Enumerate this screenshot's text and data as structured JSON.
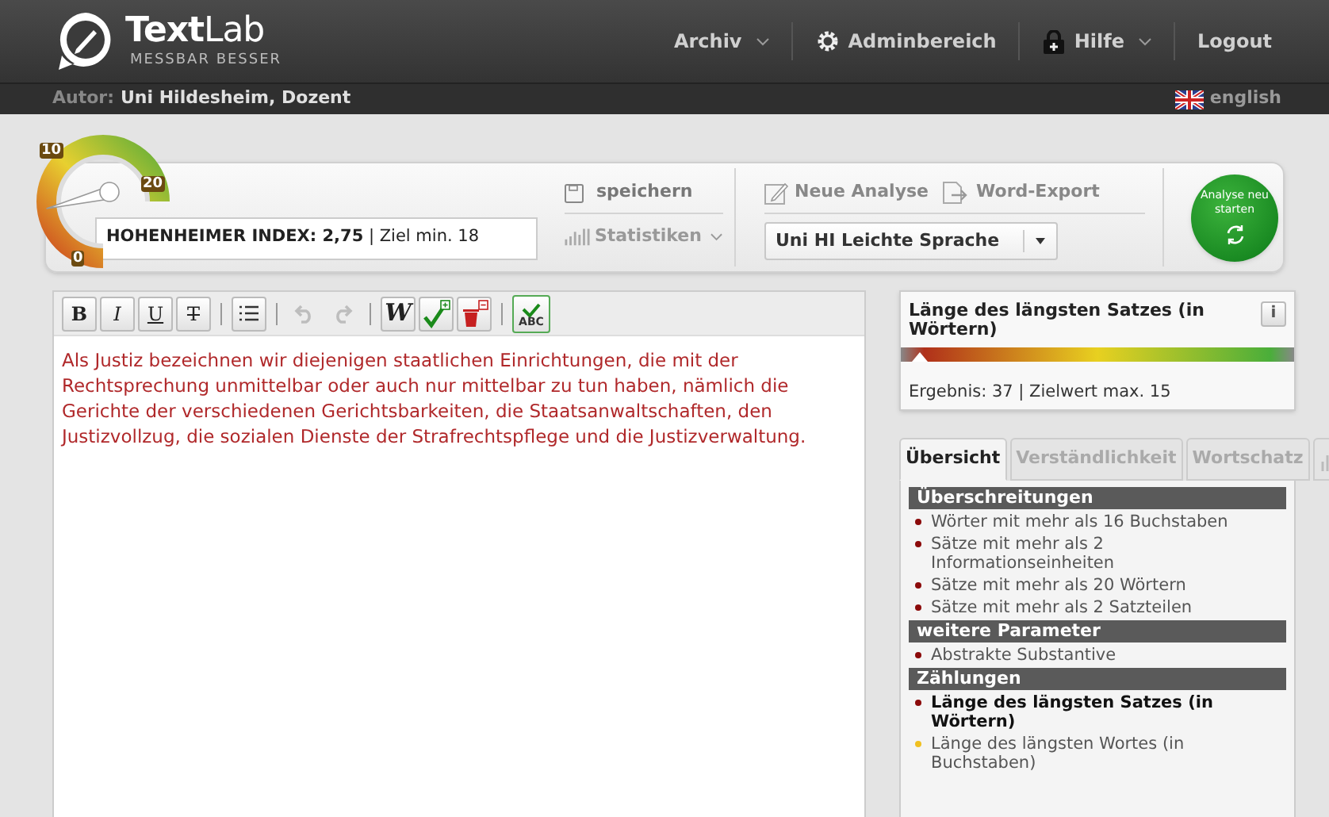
{
  "header": {
    "logo": {
      "title": "**Text**Lab",
      "tagline": "MESSBAR BESSER"
    },
    "nav": [
      {
        "label": "Archiv",
        "kind": "menu",
        "dropdown": true
      },
      {
        "label": "Adminbereich",
        "kind": "admin",
        "dropdown": false
      },
      {
        "label": "Hilfe",
        "kind": "help",
        "dropdown": true
      },
      {
        "label": "Logout",
        "kind": "link",
        "dropdown": false
      }
    ]
  },
  "subbar": {
    "author_label": "Autor:",
    "author": "Uni Hildesheim, Dozent",
    "language": "english"
  },
  "score": {
    "gauge_ticks": [
      "0",
      "10",
      "20"
    ],
    "index": "**HOHENHEIMER INDEX: 2,75** | Ziel min. 18"
  },
  "actions": {
    "save": "speichern",
    "stats": "Statistiken",
    "new_analysis": "Neue Analyse",
    "export": "Word-Export",
    "profile": "Uni HI Leichte Sprache",
    "restart": "Analyse neu starten"
  },
  "editor": {
    "tools": [
      {
        "kind": "bold",
        "label": "B",
        "disabled": false
      },
      {
        "kind": "italic",
        "label": "I",
        "disabled": false
      },
      {
        "kind": "underline",
        "label": "U",
        "disabled": false
      },
      {
        "kind": "strike",
        "label": "T",
        "disabled": false
      },
      {
        "kind": "separator"
      },
      {
        "kind": "list",
        "disabled": false
      },
      {
        "kind": "separator"
      },
      {
        "kind": "undo",
        "disabled": true
      },
      {
        "kind": "redo",
        "disabled": true
      },
      {
        "kind": "separator"
      },
      {
        "kind": "word",
        "label": "W",
        "disabled": false
      },
      {
        "kind": "check-add",
        "disabled": false
      },
      {
        "kind": "delete",
        "disabled": false
      },
      {
        "kind": "separator"
      },
      {
        "kind": "spellcheck",
        "label": "ABC",
        "disabled": false
      }
    ],
    "text": "Als Justiz bezeichnen wir diejenigen staatlichen Einrichtungen, die mit der Rechtsprechung unmittelbar oder auch nur mittelbar zu tun haben, nämlich die Gerichte der verschiedenen Gerichtsbarkeiten, die Staatsanwaltschaften, den Justizvollzug, die sozialen Dienste der Strafrechtspflege und die Justizverwaltung."
  },
  "metric": {
    "title": "Länge des längsten Satzes (in Wörtern)",
    "info": "i",
    "level": 0.05,
    "result": "Ergebnis: 37 | Zielwert max. 15"
  },
  "tabs": [
    {
      "kind": "text",
      "label": "Übersicht",
      "selected": true
    },
    {
      "kind": "text",
      "label": "Verständlichkeit",
      "selected": false
    },
    {
      "kind": "text",
      "label": "Wortschatz",
      "selected": false
    },
    {
      "kind": "chart",
      "selected": false
    }
  ],
  "sections": [
    {
      "title": "Überschreitungen",
      "items": [
        {
          "label": "Wörter mit mehr als 16 Buchstaben",
          "color": "#8b0a0a",
          "selected": false
        },
        {
          "label": "Sätze mit mehr als 2 Informationseinheiten",
          "color": "#8b0a0a",
          "selected": false
        },
        {
          "label": "Sätze mit mehr als 20 Wörtern",
          "color": "#8b0a0a",
          "selected": false
        },
        {
          "label": "Sätze mit mehr als 2 Satzteilen",
          "color": "#8b0a0a",
          "selected": false
        }
      ]
    },
    {
      "title": "weitere Parameter",
      "items": [
        {
          "label": "Abstrakte Substantive",
          "color": "#8b0a0a",
          "selected": false
        }
      ]
    },
    {
      "title": "Zählungen",
      "items": [
        {
          "label": "Länge des längsten Satzes (in Wörtern)",
          "color": "#8b0a0a",
          "selected": true
        },
        {
          "label": "Länge des längsten Wortes (in Buchstaben)",
          "color": "#f0c020",
          "selected": false
        }
      ]
    }
  ]
}
